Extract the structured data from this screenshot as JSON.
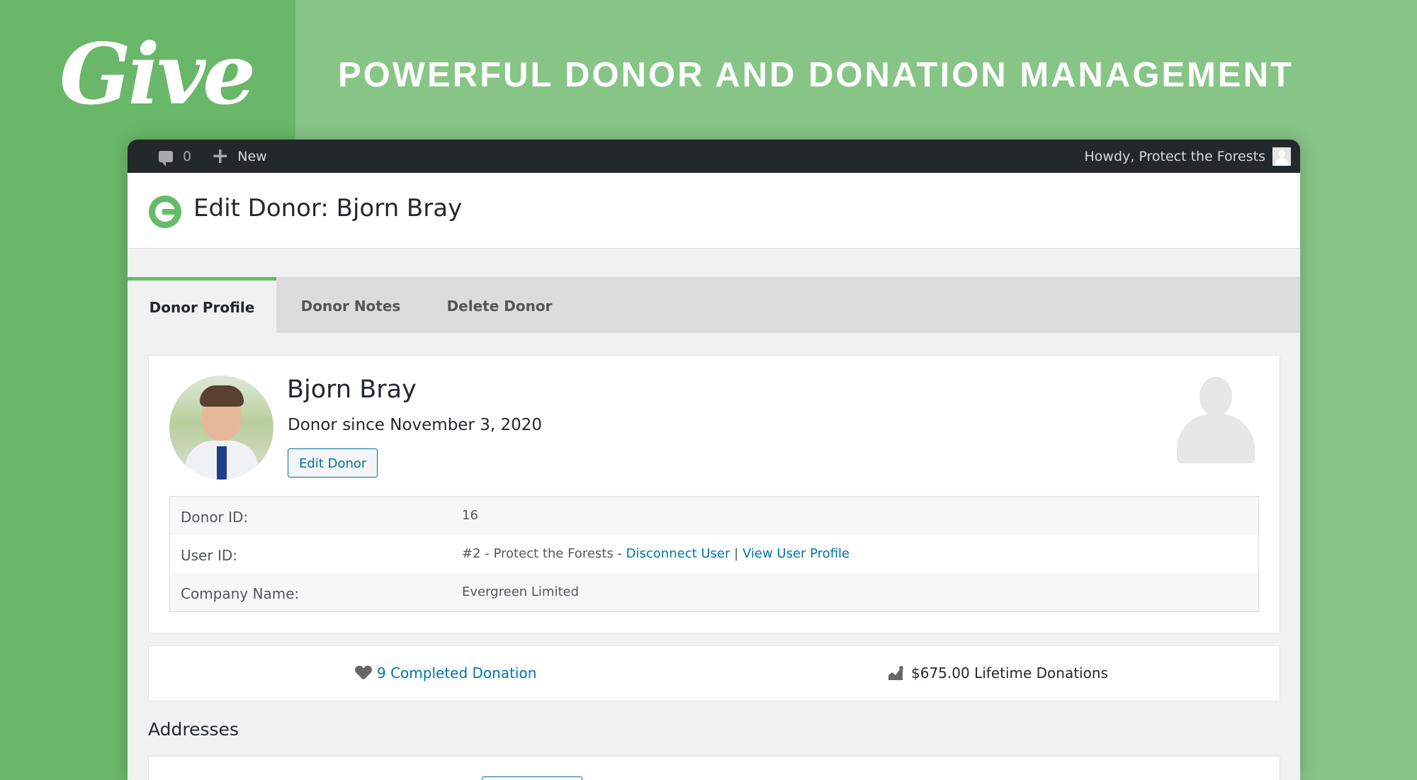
{
  "brand": {
    "logo_text": "Give",
    "headline": "POWERFUL DONOR AND DONATION MANAGEMENT"
  },
  "adminbar": {
    "comments_count": "0",
    "new_label": "New",
    "greeting": "Howdy, Protect the Forests"
  },
  "page": {
    "title": "Edit Donor: Bjorn Bray"
  },
  "tabs": [
    {
      "label": "Donor Profile",
      "active": true
    },
    {
      "label": "Donor Notes",
      "active": false
    },
    {
      "label": "Delete Donor",
      "active": false
    }
  ],
  "donor": {
    "name": "Bjorn Bray",
    "since": "Donor since November 3, 2020",
    "edit_label": "Edit Donor",
    "details": [
      {
        "label": "Donor ID:",
        "value": "16"
      },
      {
        "label": "User ID:",
        "value_prefix": "#2 - Protect the Forests - ",
        "link1": "Disconnect User",
        "separator": "|",
        "link2": "View User Profile"
      },
      {
        "label": "Company Name:",
        "value": "Evergreen Limited"
      }
    ]
  },
  "stats": {
    "completed": "9 Completed Donation",
    "lifetime": "$675.00 Lifetime Donations"
  },
  "addresses": {
    "title": "Addresses"
  },
  "colors": {
    "background": "#86c586",
    "logo_panel": "#69b869",
    "accent": "#66bb6a",
    "link": "#0073aa",
    "adminbar": "#23282d"
  },
  "icons": [
    "comment-icon",
    "plus-icon",
    "user-avatar-icon",
    "give-logo-icon",
    "donor-placeholder-icon",
    "heart-icon",
    "chart-icon"
  ]
}
